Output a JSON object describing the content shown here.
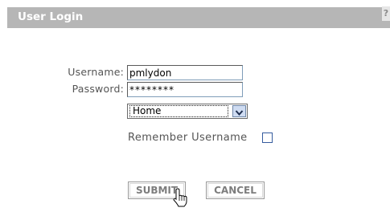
{
  "header": {
    "title": "User Login",
    "help_label": "?"
  },
  "form": {
    "username_label": "Username:",
    "username_value": "pmlydon",
    "password_label": "Password:",
    "password_value": "********",
    "location_selected": "Home",
    "remember_label": "Remember Username",
    "remember_checked": false
  },
  "buttons": {
    "submit_label": "SUBMIT",
    "cancel_label": "CANCEL"
  },
  "icons": {
    "dropdown": "chevron-down-icon",
    "pointer": "hand-pointer-icon"
  }
}
